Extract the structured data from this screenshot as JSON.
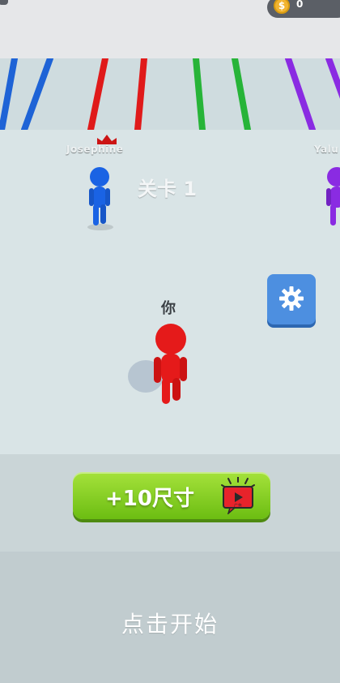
{
  "hud": {
    "coin_count": "0",
    "coin_symbol": "$"
  },
  "level": {
    "label": "关卡 1"
  },
  "players": {
    "left_name": "Josephine",
    "right_name": "Yalu",
    "you_label": "你"
  },
  "buttons": {
    "boost_label": "+10尺寸",
    "boost_icon_caption": "广告",
    "settings_icon": "gear-icon"
  },
  "prompt": {
    "start_text": "点击开始"
  },
  "colors": {
    "red_runner": "#e51a1a",
    "blue_runner": "#1760e6",
    "purple_runner": "#8a2be2",
    "green_bar": "#27b438",
    "accent_green": "#7cc919",
    "settings_blue": "#4d8fe0"
  }
}
